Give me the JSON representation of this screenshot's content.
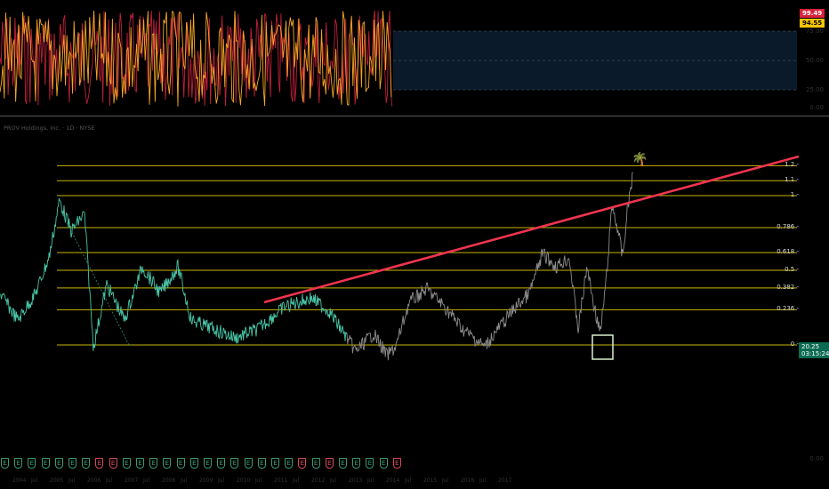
{
  "symbol_header": "PROV Holdings, Inc. · 1D · NYSE",
  "indicator": {
    "badge_top": "99.49",
    "badge_bottom": "94.55",
    "axis_labels": [
      "75.00",
      "50.00",
      "25.00",
      "0.00"
    ],
    "colors": {
      "line_a": "#f5a623",
      "line_b": "#c0203a",
      "fill": "#0b1a2a"
    }
  },
  "main_axis": {
    "labels": [
      "",
      "",
      "",
      "",
      "",
      ""
    ],
    "bottom_label": "0.00"
  },
  "fib_levels": [
    {
      "label": "1.2",
      "value": 1.2
    },
    {
      "label": "1.1",
      "value": 1.1
    },
    {
      "label": "1",
      "value": 1.0
    },
    {
      "label": "0.786",
      "value": 0.786
    },
    {
      "label": "0.618",
      "value": 0.618
    },
    {
      "label": "0.5",
      "value": 0.5
    },
    {
      "label": "0.382",
      "value": 0.382
    },
    {
      "label": "0.236",
      "value": 0.236
    },
    {
      "label": "0",
      "value": 0.0
    }
  ],
  "last_price": {
    "value": "20.25",
    "countdown": "03:15:24"
  },
  "emoji_marker": "🌴",
  "colors": {
    "fib_line": "#c9b400",
    "trendline": "#f0344e",
    "price_early": "#49c6a8",
    "price_late": "#8c8c8c",
    "highlight_box": "#d7f0d0"
  },
  "events": [
    "E",
    "E",
    "E",
    "E",
    "E",
    "E",
    "E",
    "R",
    "R",
    "E",
    "E",
    "E",
    "E",
    "E",
    "E",
    "E",
    "E",
    "E",
    "E",
    "E",
    "E",
    "E",
    "R",
    "E",
    "R",
    "E",
    "E",
    "E",
    "E",
    "R"
  ],
  "x_ticks": [
    "2004",
    "Jul",
    "2005",
    "Jul",
    "2006",
    "Jul",
    "2007",
    "Jul",
    "2008",
    "Jul",
    "2009",
    "Jul",
    "2010",
    "Jul",
    "2011",
    "Jul",
    "2012",
    "Jul",
    "2013",
    "Jul",
    "2014",
    "Jul",
    "2015",
    "Jul",
    "2016",
    "Jul",
    "2017"
  ]
}
